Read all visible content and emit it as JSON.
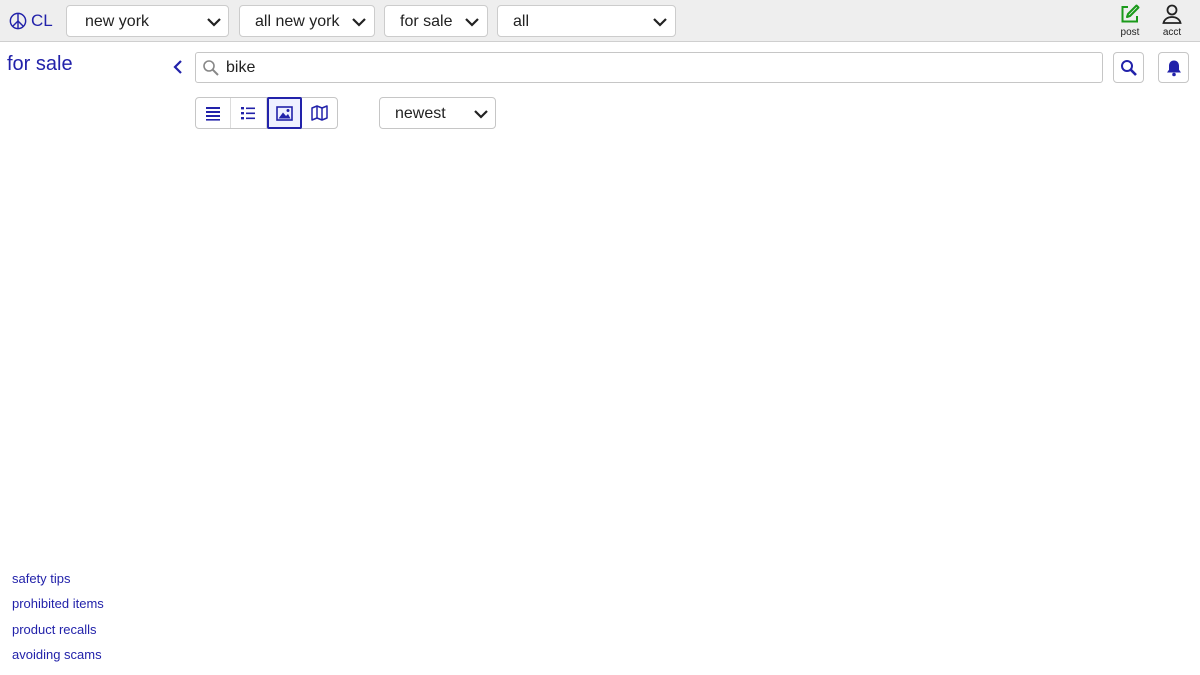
{
  "header": {
    "logo_text": "CL",
    "area_select": "new york",
    "subarea_select": "all new york",
    "category_select": "for sale",
    "subcategory_select": "all",
    "post_label": "post",
    "acct_label": "acct"
  },
  "sidebar": {
    "title": "for sale",
    "footer_links": [
      "safety tips",
      "prohibited items",
      "product recalls",
      "avoiding scams"
    ]
  },
  "search": {
    "value": "bike"
  },
  "results": {
    "sort_select": "newest",
    "view_modes": [
      "list-icon",
      "compact-list-icon",
      "gallery-icon",
      "map-icon"
    ],
    "active_view": "gallery-icon"
  },
  "colors": {
    "link": "#2222aa",
    "post_icon": "#1a9a1a",
    "header_bg": "#eeeeee"
  }
}
